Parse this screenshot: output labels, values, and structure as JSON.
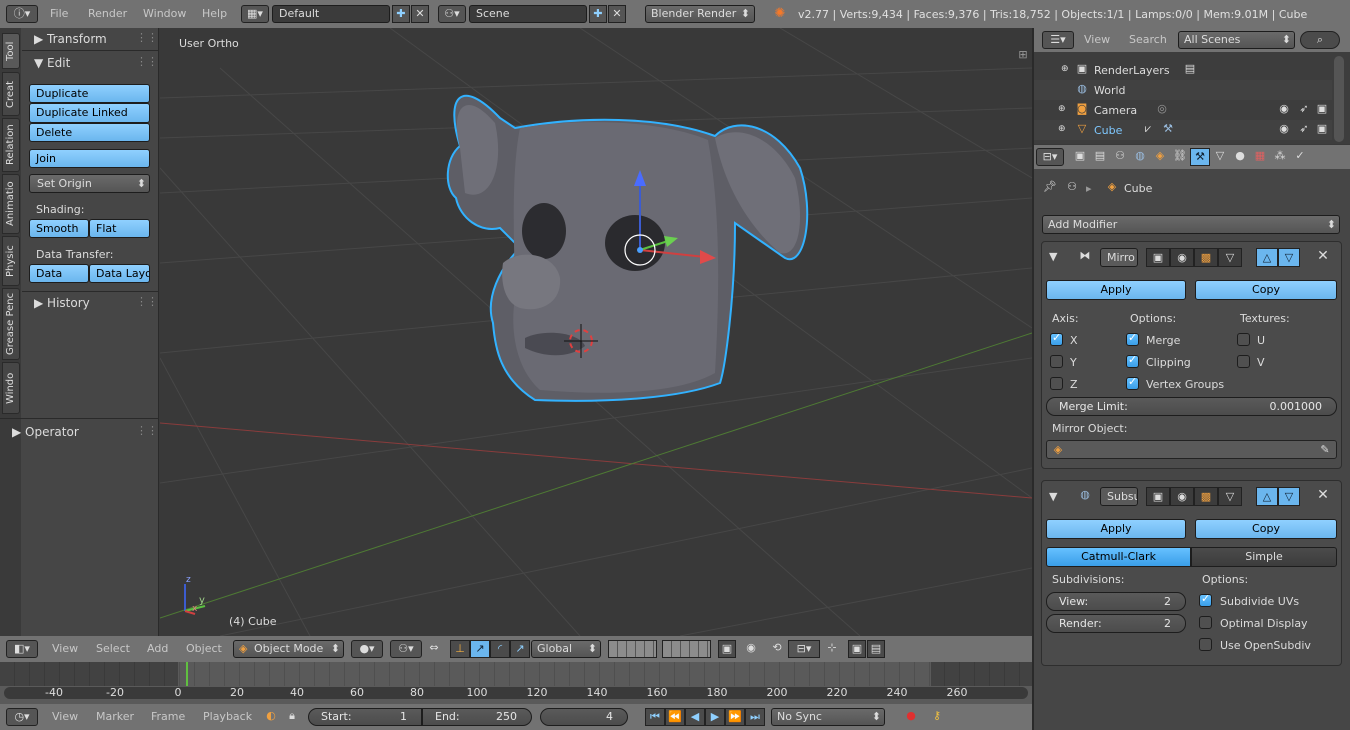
{
  "topbar": {
    "menus": [
      "File",
      "Render",
      "Window",
      "Help"
    ],
    "screen_layout": "Default",
    "scene": "Scene",
    "render_engine": "Blender Render",
    "stats": "v2.77 | Verts:9,434 | Faces:9,376 | Tris:18,752 | Objects:1/1 | Lamps:0/0 | Mem:9.01M | Cube"
  },
  "tool_tabs": [
    "Tool",
    "Creat",
    "Relation",
    "Animatio",
    "Physic",
    "Grease Penc",
    "Windo"
  ],
  "tool_panel": {
    "transform_header": "Transform",
    "edit_header": "Edit",
    "duplicate": "Duplicate",
    "duplicate_linked": "Duplicate Linked",
    "delete": "Delete",
    "join": "Join",
    "set_origin": "Set Origin",
    "shading_label": "Shading:",
    "smooth": "Smooth",
    "flat": "Flat",
    "data_transfer_label": "Data Transfer:",
    "data": "Data",
    "data_layout": "Data Layo",
    "history_header": "History",
    "operator_header": "Operator"
  },
  "viewport": {
    "view_label": "User Ortho",
    "object_label": "(4) Cube",
    "axis_x": "x",
    "axis_y": "y",
    "axis_z": "z"
  },
  "viewport_header": {
    "menus": [
      "View",
      "Select",
      "Add",
      "Object"
    ],
    "mode": "Object Mode",
    "orientation": "Global"
  },
  "timeline": {
    "ticks": [
      "-40",
      "-20",
      "0",
      "20",
      "40",
      "60",
      "80",
      "100",
      "120",
      "140",
      "160",
      "180",
      "200",
      "220",
      "240",
      "260"
    ],
    "menus": [
      "View",
      "Marker",
      "Frame",
      "Playback"
    ],
    "start_label": "Start:",
    "start_value": "1",
    "end_label": "End:",
    "end_value": "250",
    "current_frame": "4",
    "sync": "No Sync"
  },
  "outliner": {
    "menus": [
      "View",
      "Search"
    ],
    "scenes_select": "All Scenes",
    "items": [
      "RenderLayers",
      "World",
      "Camera",
      "Cube"
    ]
  },
  "properties": {
    "breadcrumb_object": "Cube",
    "add_modifier": "Add Modifier",
    "mirror": {
      "name": "Mirro",
      "apply": "Apply",
      "copy": "Copy",
      "axis_label": "Axis:",
      "options_label": "Options:",
      "textures_label": "Textures:",
      "x": "X",
      "y": "Y",
      "z": "Z",
      "merge": "Merge",
      "clipping": "Clipping",
      "vertex_groups": "Vertex Groups",
      "u": "U",
      "v": "V",
      "merge_limit_label": "Merge Limit:",
      "merge_limit_value": "0.001000",
      "mirror_object_label": "Mirror Object:"
    },
    "subsurf": {
      "name": "Subsu",
      "apply": "Apply",
      "copy": "Copy",
      "catmull_clark": "Catmull-Clark",
      "simple": "Simple",
      "subdivisions_label": "Subdivisions:",
      "options_label": "Options:",
      "view_label": "View:",
      "view_value": "2",
      "render_label": "Render:",
      "render_value": "2",
      "subdivide_uvs": "Subdivide UVs",
      "optimal_display": "Optimal Display",
      "use_opensubdiv": "Use OpenSubdiv"
    }
  },
  "colors": {
    "accent_blue": "#6bb6ee",
    "selection_outline": "#32b2ff",
    "x_axis": "#c04040",
    "y_axis": "#5c9a3c"
  }
}
